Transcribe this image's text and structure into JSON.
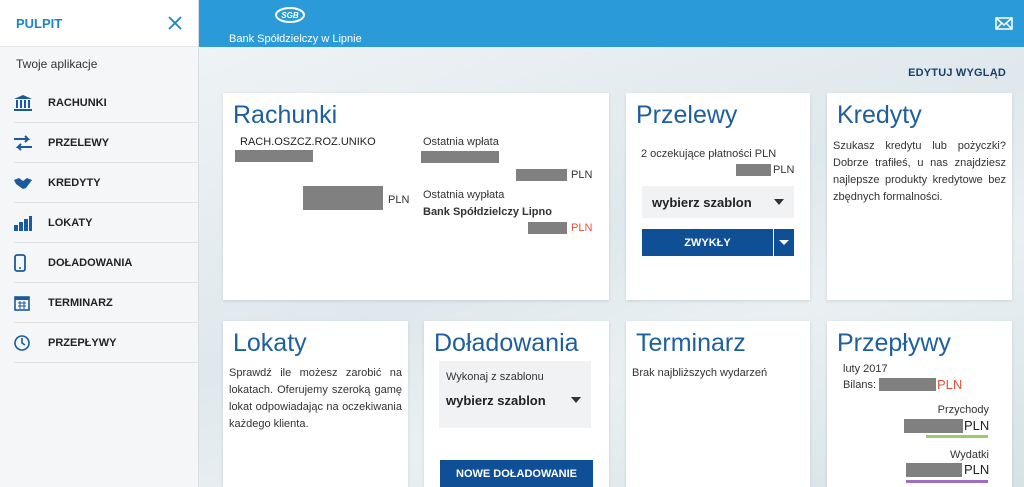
{
  "sidebar": {
    "title": "PULPIT",
    "section_label": "Twoje aplikacje",
    "items": [
      {
        "label": "RACHUNKI",
        "icon": "bank-icon"
      },
      {
        "label": "PRZELEWY",
        "icon": "transfer-arrows-icon"
      },
      {
        "label": "KREDYTY",
        "icon": "handshake-icon"
      },
      {
        "label": "LOKATY",
        "icon": "coins-icon"
      },
      {
        "label": "DOŁADOWANIA",
        "icon": "phone-icon"
      },
      {
        "label": "TERMINARZ",
        "icon": "calendar-icon"
      },
      {
        "label": "PRZEPŁYWY",
        "icon": "clock-icon"
      }
    ]
  },
  "header": {
    "bank_name": "Bank Spółdzielczy w Lipnie",
    "logo_text": "SGB"
  },
  "edit_layout_label": "EDYTUJ WYGLĄD",
  "cards": {
    "rachunki": {
      "title": "Rachunki",
      "account_name": "RACH.OSZCZ.ROZ.UNIKO",
      "balance_currency": "PLN",
      "last_deposit_label": "Ostatnia wpłata",
      "last_deposit_currency": "PLN",
      "last_withdrawal_label": "Ostatnia wypłata",
      "last_withdrawal_party": "Bank Spółdzielczy Lipno",
      "last_withdrawal_currency": "PLN"
    },
    "przelewy": {
      "title": "Przelewy",
      "pending": "2 oczekujące płatności PLN",
      "pending_currency": "PLN",
      "template_select": "wybierz szablon",
      "button": "ZWYKŁY"
    },
    "kredyty": {
      "title": "Kredyty",
      "text": "Szukasz kredytu lub pożyczki? Dobrze trafiłeś, u nas znajdziesz najlepsze produkty kredytowe bez zbędnych formalności."
    },
    "lokaty": {
      "title": "Lokaty",
      "text": "Sprawdź ile możesz zarobić na lokatach. Oferujemy szeroką gamę lokat odpowiadając na oczekiwania każdego klienta."
    },
    "doladowania": {
      "title": "Doładowania",
      "template_label": "Wykonaj z szablonu",
      "template_select": "wybierz szablon",
      "button": "NOWE DOŁADOWANIE"
    },
    "terminarz": {
      "title": "Terminarz",
      "text": "Brak najbliższych wydarzeń"
    },
    "przeplywy": {
      "title": "Przepływy",
      "period": "luty 2017",
      "balance_label": "Bilans:",
      "balance_currency": "PLN",
      "income_label": "Przychody",
      "income_currency": "PLN",
      "expenses_label": "Wydatki",
      "expenses_currency": "PLN",
      "colors": {
        "income": "#9ccc65",
        "expenses": "#9b6fc4"
      }
    }
  },
  "colors": {
    "accent": "#2a9ad9",
    "title_blue": "#1e5fa0",
    "button_navy": "#0f4f96",
    "negative": "#e2533a"
  }
}
